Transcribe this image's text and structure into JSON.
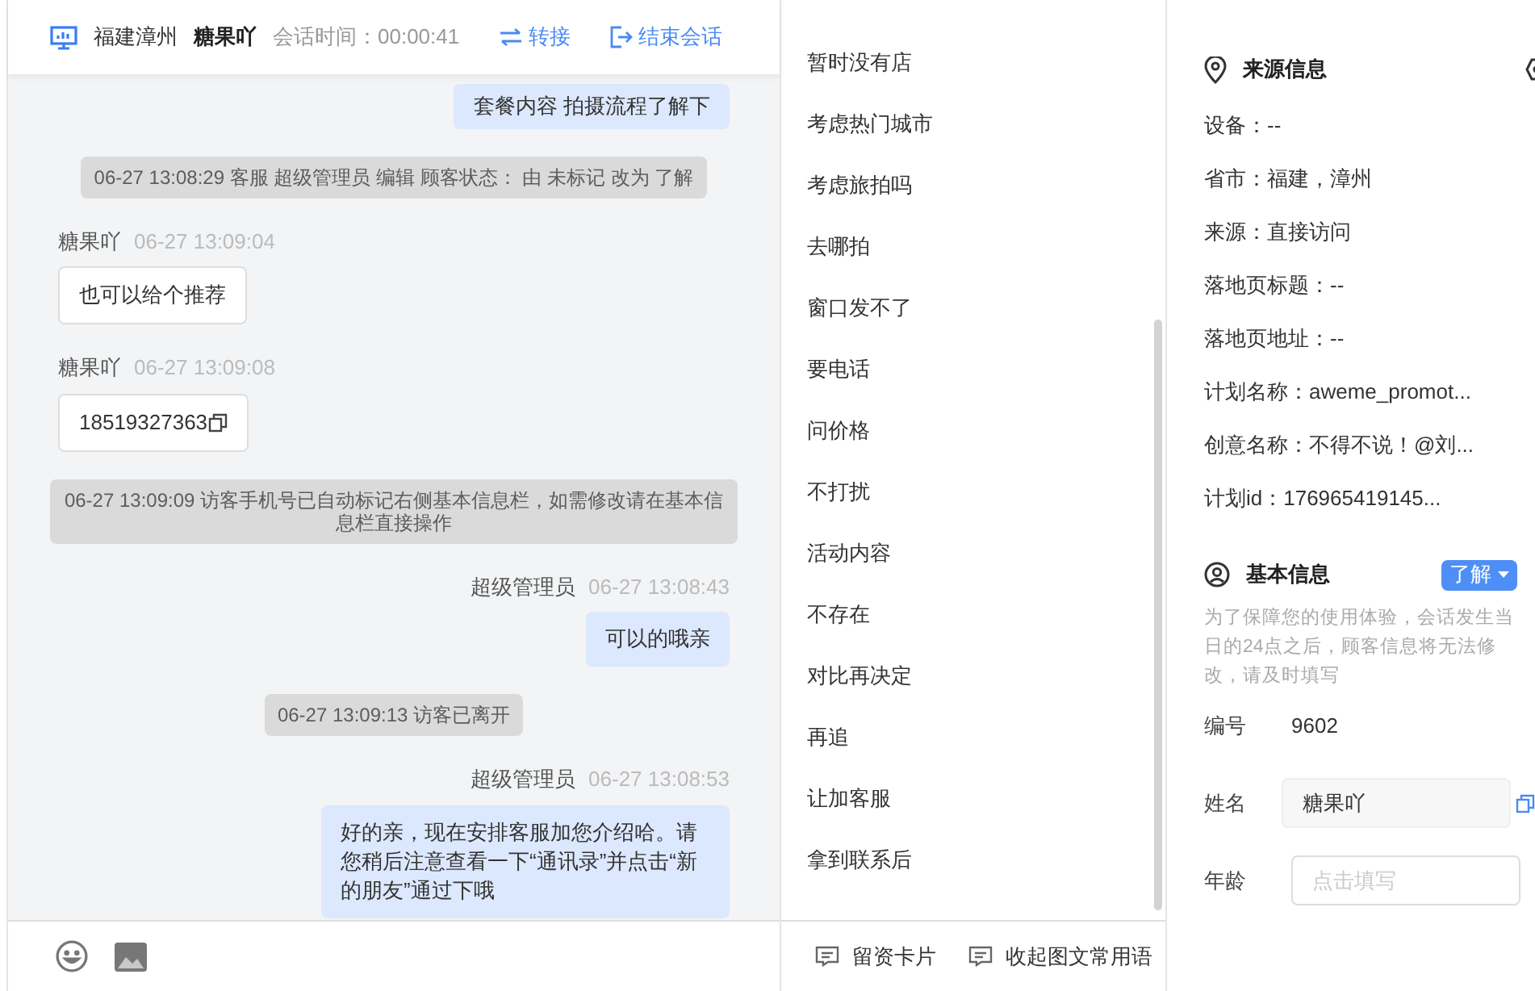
{
  "header": {
    "location": "福建漳州",
    "visitor": "糖果吖",
    "timer_label": "会话时间：",
    "timer": "00:00:41",
    "actions": [
      {
        "kind": "transfer",
        "label": "转接"
      },
      {
        "kind": "end",
        "label": "结束会话"
      }
    ]
  },
  "messages": [
    {
      "kind": "agent",
      "text": "套餐内容 拍摄流程了解下"
    },
    {
      "kind": "system",
      "text": "06-27 13:08:29 客服 超级管理员 编辑 顾客状态： 由 未标记 改为 了解"
    },
    {
      "kind": "visitor",
      "name": "糖果吖",
      "time": "06-27 13:09:04",
      "text": "也可以给个推荐"
    },
    {
      "kind": "visitor",
      "name": "糖果吖",
      "time": "06-27 13:09:08",
      "text": "18519327363",
      "copyable": true
    },
    {
      "kind": "system",
      "text": "06-27 13:09:09 访客手机号已自动标记右侧基本信息栏，如需修改请在基本信息栏直接操作"
    },
    {
      "kind": "agent",
      "name": "超级管理员",
      "time": "06-27 13:08:43",
      "text": "可以的哦亲"
    },
    {
      "kind": "system",
      "text": "06-27 13:09:13 访客已离开"
    },
    {
      "kind": "agent",
      "name": "超级管理员",
      "time": "06-27 13:08:53",
      "text": "好的亲，现在安排客服加您介绍哈。请您稍后注意查看一下“通讯录”并点击“新的朋友”通过下哦"
    }
  ],
  "phrases": [
    "暂时没有店",
    "考虑热门城市",
    "考虑旅拍吗",
    "去哪拍",
    "窗口发不了",
    "要电话",
    "问价格",
    "不打扰",
    "活动内容",
    "不存在",
    "对比再决定",
    "再追",
    "让加客服",
    "拿到联系后"
  ],
  "bottom_actions": [
    "留资卡片",
    "收起图文常用语"
  ],
  "source": {
    "title": "来源信息",
    "rows": [
      "设备：--",
      "省市：福建，漳州",
      "来源：直接访问",
      "落地页标题：--",
      "落地页地址：--",
      "计划名称：aweme_promot...",
      "创意名称：不得不说！@刘...",
      "计划id：176965419145..."
    ]
  },
  "basic": {
    "title": "基本信息",
    "status": "了解",
    "note": "为了保障您的使用体验，会话发生当日的24点之后，顾客信息将无法修改，请及时填写",
    "fields": [
      {
        "kind": "text",
        "label": "编号",
        "value": "9602"
      },
      {
        "kind": "filled",
        "label": "姓名",
        "value": "糖果吖"
      },
      {
        "kind": "input",
        "label": "年龄",
        "placeholder": "点击填写"
      }
    ]
  }
}
